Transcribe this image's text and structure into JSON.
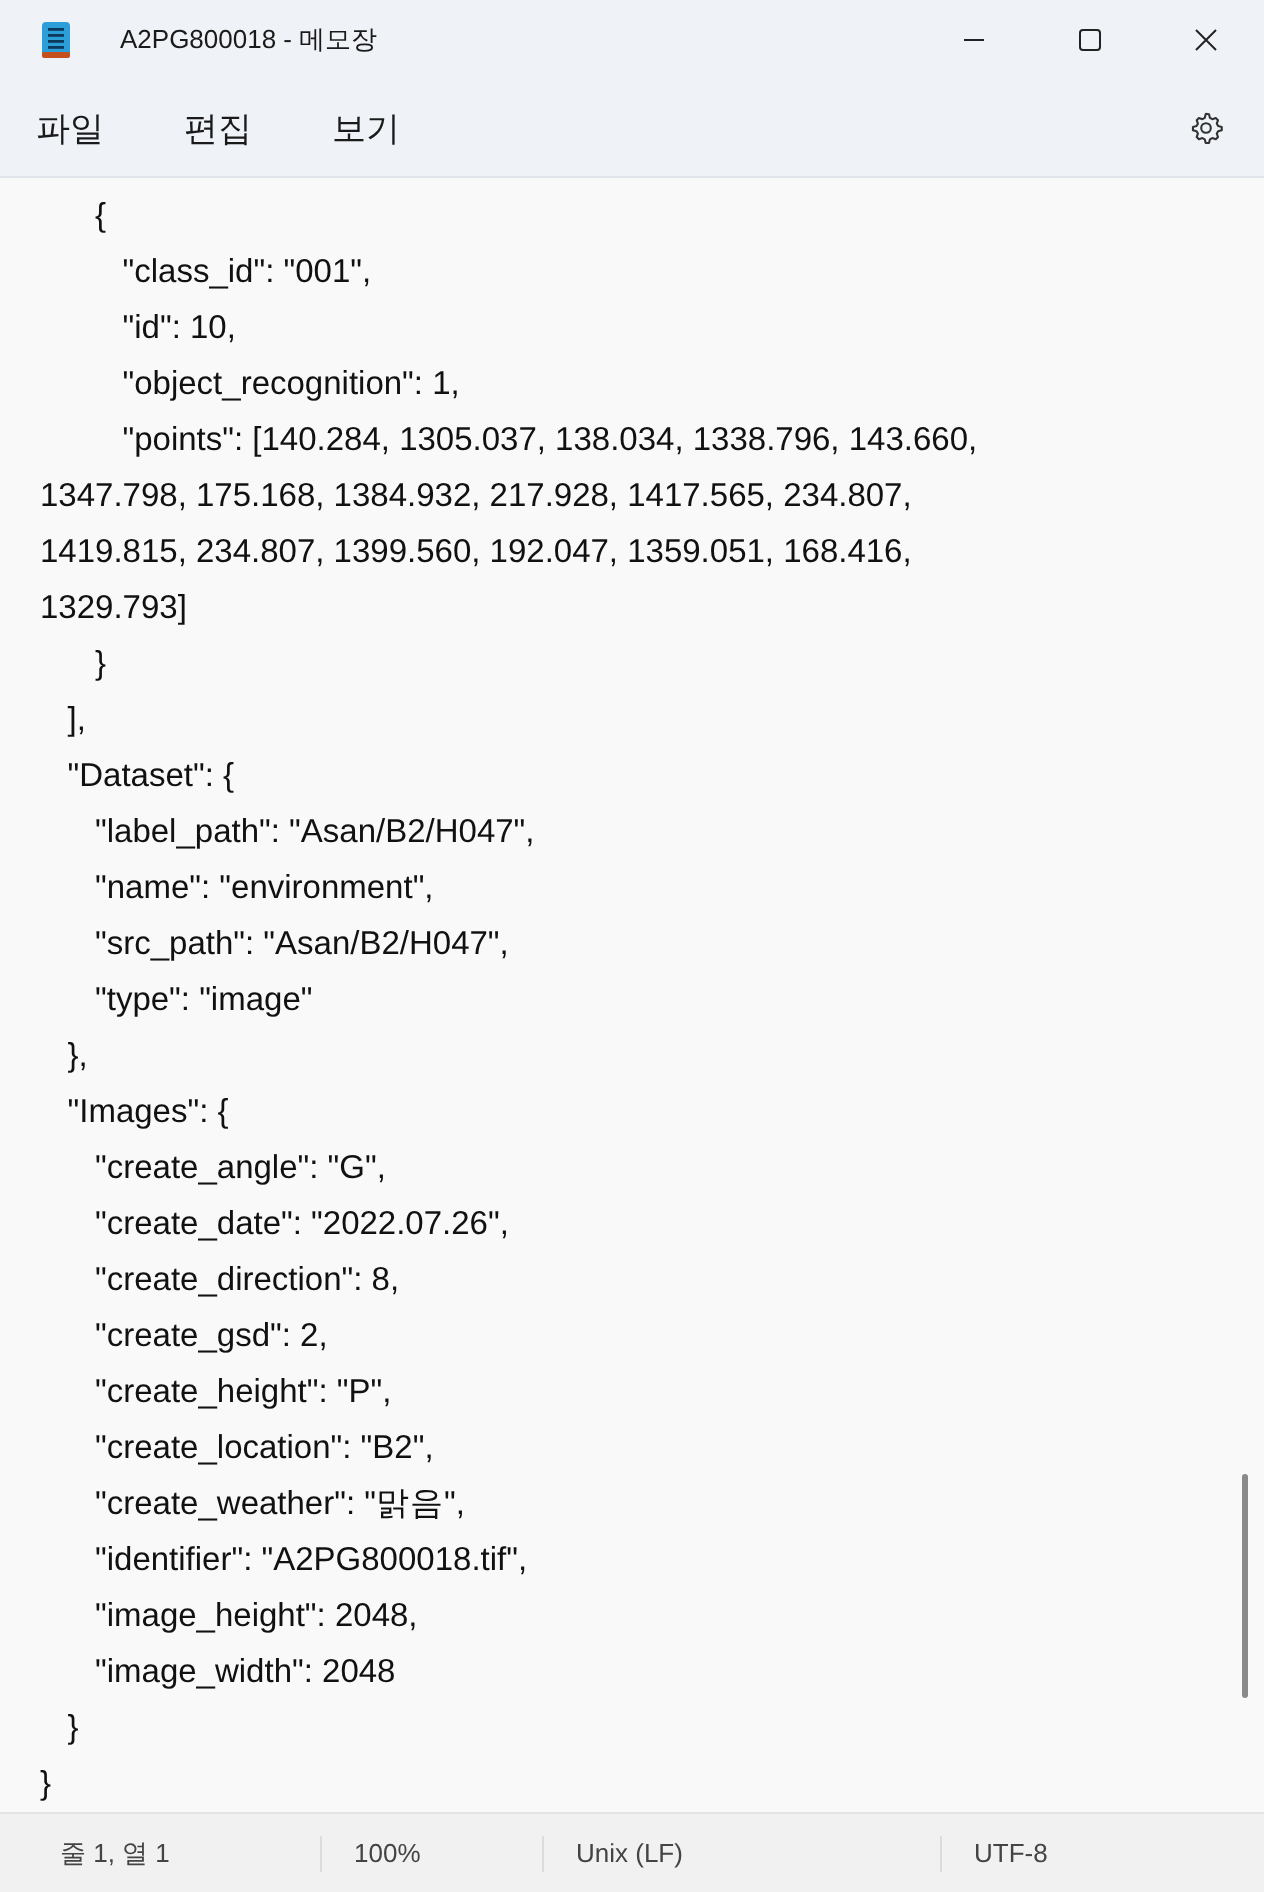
{
  "window": {
    "title": "A2PG800018 - 메모장"
  },
  "menu": [
    {
      "label": "파일"
    },
    {
      "label": "편집"
    },
    {
      "label": "보기"
    }
  ],
  "lines": [
    "      {",
    "         \"class_id\": \"001\",",
    "         \"id\": 10,",
    "         \"object_recognition\": 1,",
    "         \"points\": [140.284, 1305.037, 138.034, 1338.796, 143.660,",
    "1347.798, 175.168, 1384.932, 217.928, 1417.565, 234.807,",
    "1419.815, 234.807, 1399.560, 192.047, 1359.051, 168.416,",
    "1329.793]",
    "      }",
    "   ],",
    "   \"Dataset\": {",
    "      \"label_path\": \"Asan/B2/H047\",",
    "      \"name\": \"environment\",",
    "      \"src_path\": \"Asan/B2/H047\",",
    "      \"type\": \"image\"",
    "   },",
    "   \"Images\": {",
    "      \"create_angle\": \"G\",",
    "      \"create_date\": \"2022.07.26\",",
    "      \"create_direction\": 8,",
    "      \"create_gsd\": 2,",
    "      \"create_height\": \"P\",",
    "      \"create_location\": \"B2\",",
    "      \"create_weather\": \"맑음\",",
    "      \"identifier\": \"A2PG800018.tif\",",
    "      \"image_height\": 2048,",
    "      \"image_width\": 2048",
    "   }",
    "}"
  ],
  "status_bar": {
    "position": "줄 1, 열 1",
    "zoom": "100%",
    "line_ending": "Unix (LF)",
    "encoding": "UTF-8"
  }
}
